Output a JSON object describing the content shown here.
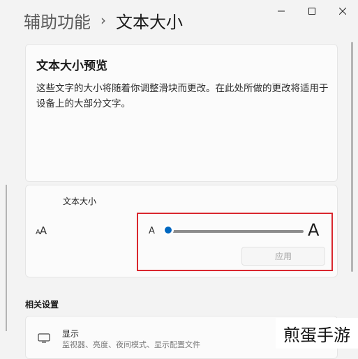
{
  "breadcrumb": {
    "parent": "辅助功能",
    "separator": "›",
    "current": "文本大小"
  },
  "preview": {
    "title": "文本大小预览",
    "body": "这些文字的大小将随着你调整滑块而更改。在此处所做的更改将适用于设备上的大部分文字。"
  },
  "text_size": {
    "title": "文本大小",
    "icon": "text-size-icon",
    "slider": {
      "min_label": "A",
      "max_label": "A",
      "level": 0
    },
    "apply_label": "应用"
  },
  "related": {
    "header": "相关设置",
    "display": {
      "title": "显示",
      "subtitle": "监视器、亮度、夜间模式、显示配置文件",
      "icon": "monitor-icon"
    }
  },
  "watermark": "煎蛋手游",
  "colors": {
    "accent": "#0067c0",
    "highlight": "#d9272e",
    "background": "#f3f3f3"
  }
}
